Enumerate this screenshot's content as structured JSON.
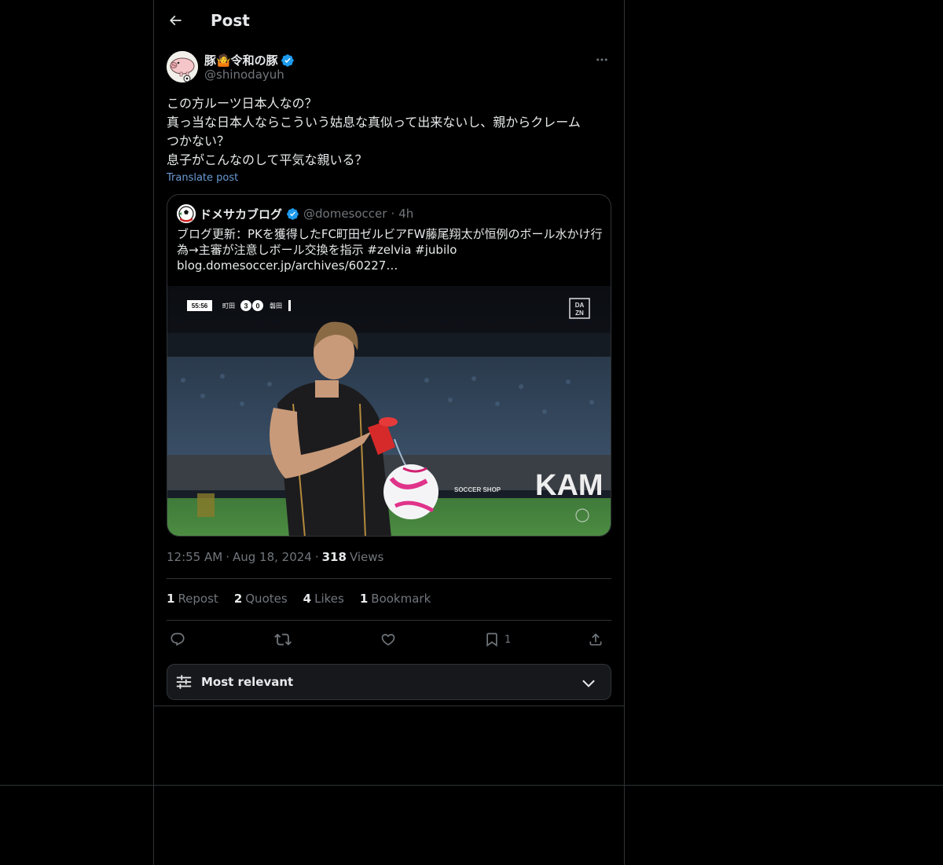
{
  "header": {
    "title": "Post",
    "back_icon": "arrow-left-icon"
  },
  "post": {
    "author": {
      "name": "豚🤷令和の豚",
      "handle": "@shinodayuh",
      "verified": true
    },
    "text_lines": [
      "この方ルーツ日本人なの？",
      "真っ当な日本人ならこういう姑息な真似って出来ないし、親からクレーム",
      "つかない？",
      "息子がこんなのして平気な親いる？"
    ],
    "translate_label": "Translate post",
    "quote": {
      "name": "ドメサカブログ",
      "handle": "@domesoccer",
      "time": "4h",
      "verified": true,
      "text_lines": [
        "ブログ更新：PKを獲得したFC町田ゼルビアFW藤尾翔太が恒例のボール水かけ行",
        "為→主審が注意しボール交換を指示 #zelvia #jubilo",
        "blog.domesoccer.jp/archives/60227…"
      ],
      "media": {
        "scoreboard_time": "55:56",
        "home": "町田",
        "home_score": "3",
        "away_score": "0",
        "away": "磐田",
        "broadcaster": "DAZN",
        "board_text": "KAM",
        "board_small": "SOCCER SHOP"
      }
    },
    "time": "12:55 AM",
    "date": "Aug 18, 2024",
    "views_count": "318",
    "views_label": "Views",
    "stats": {
      "reposts": "1",
      "reposts_label": "Repost",
      "quotes": "2",
      "quotes_label": "Quotes",
      "likes": "4",
      "likes_label": "Likes",
      "bookmarks": "1",
      "bookmarks_label": "Bookmark"
    },
    "actions": {
      "bookmark_count": "1"
    }
  },
  "sort": {
    "label": "Most relevant"
  },
  "colors": {
    "background": "#000000",
    "text": "#e7e9ea",
    "muted": "#71767b",
    "link": "#6a9bd6",
    "verified": "#1d9bf0",
    "border": "#2f3336"
  }
}
